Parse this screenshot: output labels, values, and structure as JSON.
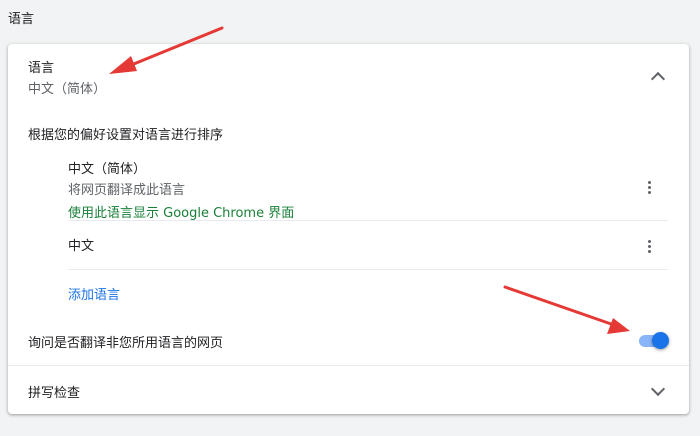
{
  "section": {
    "title": "语言"
  },
  "languages_card": {
    "header": {
      "title": "语言",
      "current_value": "中文（简体）"
    },
    "order_label": "根据您的偏好设置对语言进行排序",
    "items": [
      {
        "name": "中文（简体）",
        "translate_note": "将网页翻译成此语言",
        "display_note": "使用此语言显示 Google Chrome 界面"
      },
      {
        "name": "中文"
      }
    ],
    "add_language_label": "添加语言",
    "offer_translate": {
      "label": "询问是否翻译非您所用语言的网页",
      "enabled": true
    }
  },
  "spell_check": {
    "label": "拼写检查"
  },
  "colors": {
    "accent": "#1a73e8",
    "toggle_track": "#8ab4f8",
    "green_note": "#188038",
    "annotation_arrow": "#e53935"
  },
  "icons": [
    "chevron-up-icon",
    "more-vert-icon",
    "chevron-down-icon",
    "red-arrow"
  ]
}
